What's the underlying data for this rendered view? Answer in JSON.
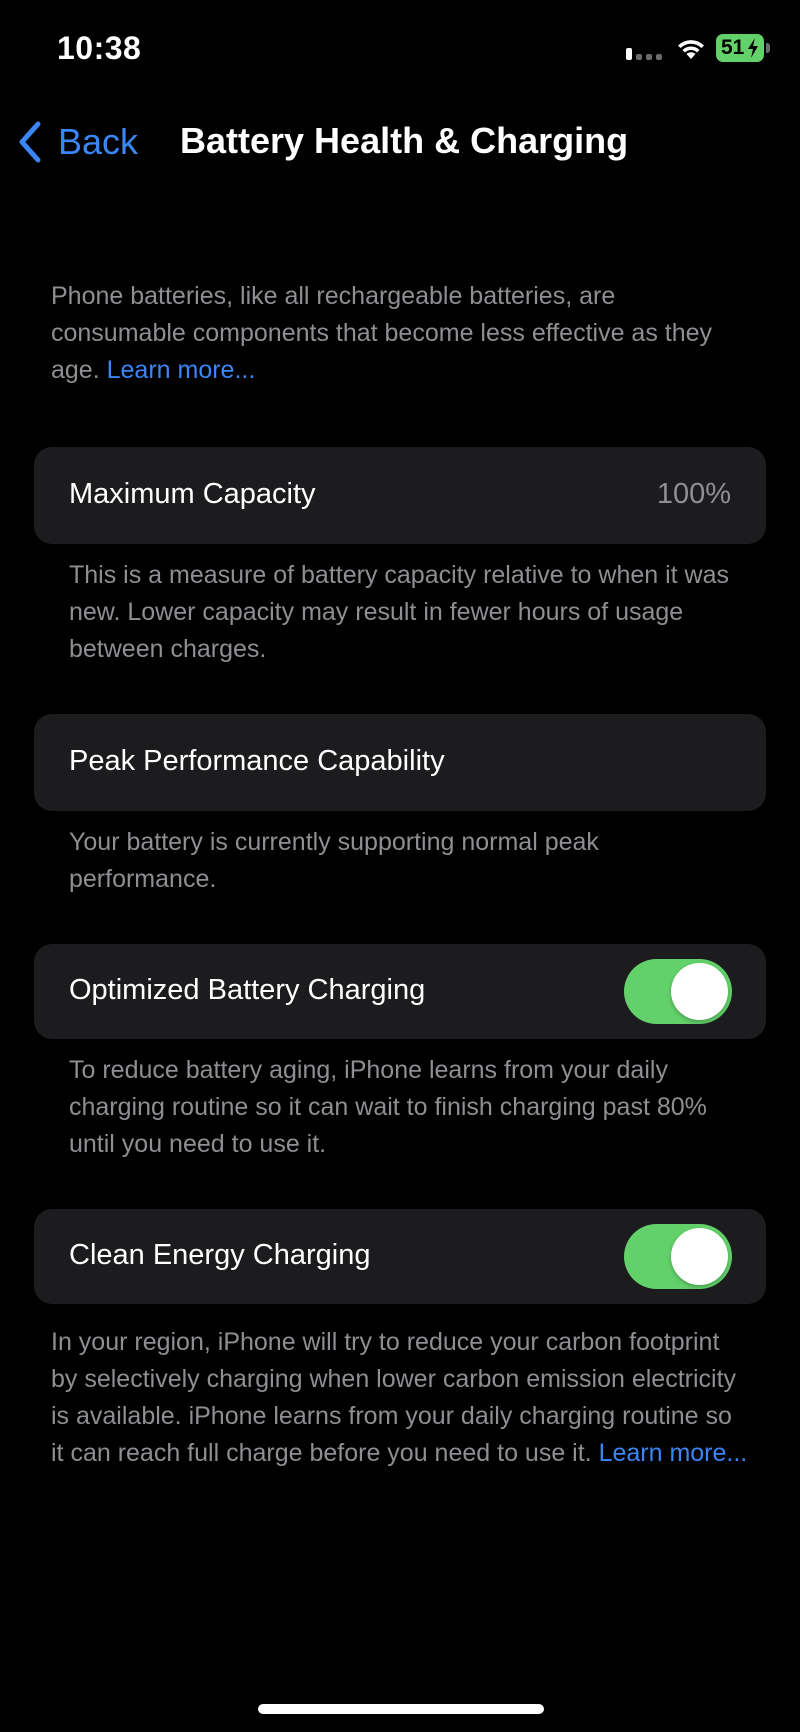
{
  "status_bar": {
    "time": "10:38",
    "battery_level": "51",
    "charging": true,
    "signal_icon": "cellular-signal-icon",
    "wifi_icon": "wifi-icon",
    "battery_color": "#63d16a"
  },
  "nav": {
    "back_label": "Back",
    "back_icon": "chevron-left-icon",
    "title": "Battery Health & Charging"
  },
  "intro": {
    "text": "Phone batteries, like all rechargeable batteries, are consumable components that become less effective as they age. ",
    "link": "Learn more..."
  },
  "sections": {
    "max_capacity": {
      "label": "Maximum Capacity",
      "value": "100%",
      "footnote": "This is a measure of battery capacity relative to when it was new. Lower capacity may result in fewer hours of usage between charges."
    },
    "peak_performance": {
      "label": "Peak Performance Capability",
      "footnote": "Your battery is currently supporting normal peak performance."
    },
    "optimized_charging": {
      "label": "Optimized Battery Charging",
      "enabled": true,
      "footnote": "To reduce battery aging, iPhone learns from your daily charging routine so it can wait to finish charging past 80% until you need to use it."
    },
    "clean_energy": {
      "label": "Clean Energy Charging",
      "enabled": true,
      "footnote": "In your region, iPhone will try to reduce your carbon footprint by selectively charging when lower carbon emission electricity is available. iPhone learns from your daily charging routine so it can reach full charge before you need to use it. ",
      "link": "Learn more..."
    }
  },
  "colors": {
    "background": "#000000",
    "card": "#1c1c1e",
    "accent": "#3a86f7",
    "toggle_on": "#63d16a",
    "secondary_text": "#8e8e93"
  }
}
